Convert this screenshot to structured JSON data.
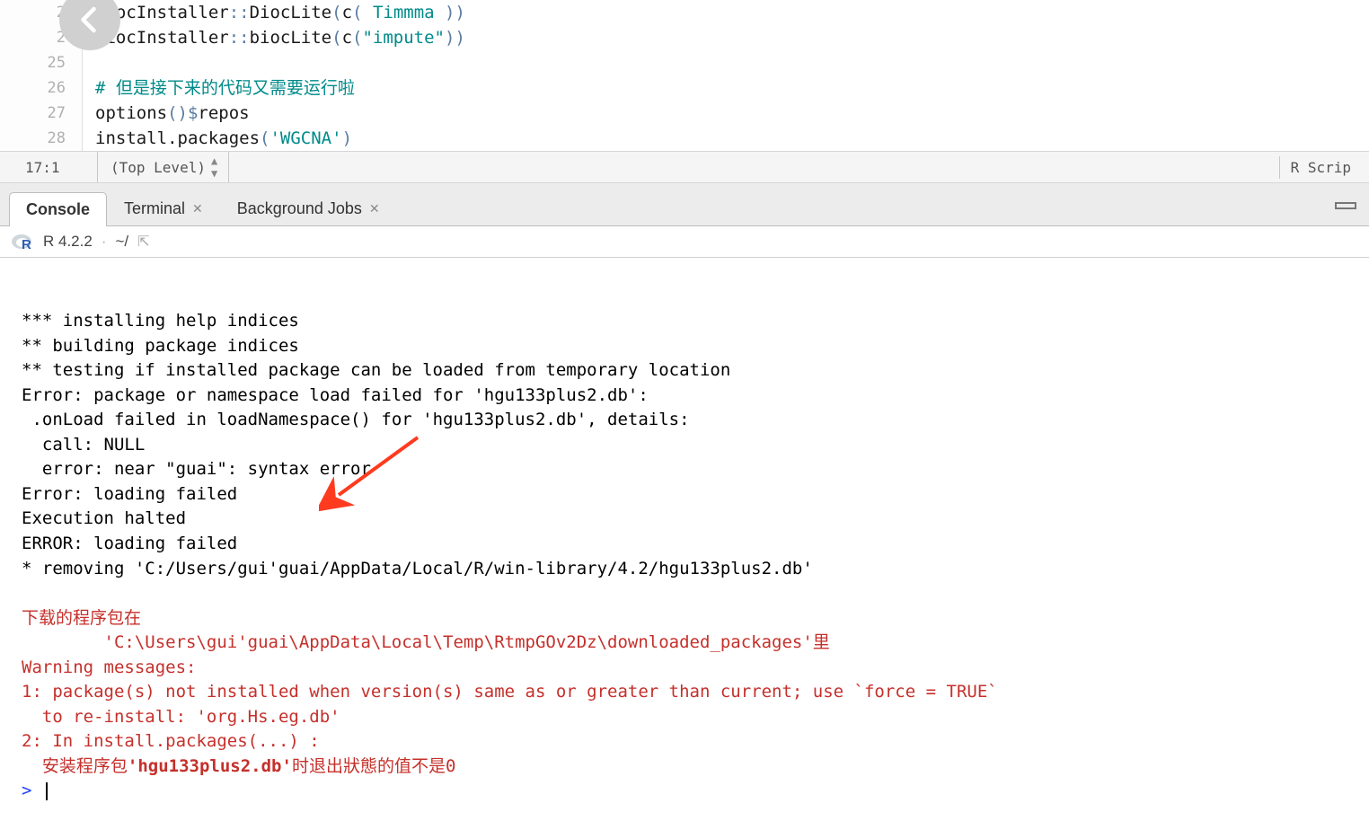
{
  "editor": {
    "lines": [
      {
        "num": "2",
        "html": "<span class='tok-ident'>DiocInstaller</span><span class='tok-op'>::</span><span class='tok-ident'>DiocLite</span><span class='tok-op'>(</span><span class='tok-ident'>c</span><span class='tok-op'>(</span> <span class='tok-str'>Timmma</span> <span class='tok-op'>))</span>"
      },
      {
        "num": "2",
        "html": "<span class='tok-ident'>BiocInstaller</span><span class='tok-op'>::</span><span class='tok-ident'>biocLite</span><span class='tok-op'>(</span><span class='tok-ident'>c</span><span class='tok-op'>(</span><span class='tok-str'>\"impute\"</span><span class='tok-op'>))</span>"
      },
      {
        "num": "25",
        "html": ""
      },
      {
        "num": "26",
        "html": "<span class='tok-comment'># 但是接下来的代码又需要运行啦</span>"
      },
      {
        "num": "27",
        "html": "<span class='tok-ident'>options</span><span class='tok-op'>()</span><span class='tok-dollar'>$</span><span class='tok-ident'>repos</span>"
      },
      {
        "num": "28",
        "html": "<span class='tok-ident'>install.packages</span><span class='tok-op'>(</span><span class='tok-str'>'WGCNA'</span><span class='tok-op'>)</span>"
      }
    ],
    "cursor_pos": "17:1",
    "scope": "(Top Level)",
    "language": "R Scrip"
  },
  "tabs": {
    "items": [
      {
        "label": "Console",
        "active": true,
        "closable": false
      },
      {
        "label": "Terminal",
        "active": false,
        "closable": true
      },
      {
        "label": "Background Jobs",
        "active": false,
        "closable": true
      }
    ]
  },
  "console_header": {
    "version": "R 4.2.2",
    "sep": "·",
    "cwd": "~/"
  },
  "console": {
    "lines": [
      {
        "cls": "cout-black",
        "text": "*** installing help indices"
      },
      {
        "cls": "cout-black",
        "text": "** building package indices"
      },
      {
        "cls": "cout-black",
        "text": "** testing if installed package can be loaded from temporary location"
      },
      {
        "cls": "cout-black",
        "text": "Error: package or namespace load failed for 'hgu133plus2.db':"
      },
      {
        "cls": "cout-black",
        "text": " .onLoad failed in loadNamespace() for 'hgu133plus2.db', details:"
      },
      {
        "cls": "cout-black",
        "text": "  call: NULL"
      },
      {
        "cls": "cout-black",
        "text": "  error: near \"guai\": syntax error"
      },
      {
        "cls": "cout-black",
        "text": "Error: loading failed"
      },
      {
        "cls": "cout-black",
        "text": "Execution halted"
      },
      {
        "cls": "cout-black",
        "text": "ERROR: loading failed"
      },
      {
        "cls": "cout-black",
        "text": "* removing 'C:/Users/gui'guai/AppData/Local/R/win-library/4.2/hgu133plus2.db'"
      },
      {
        "cls": "cout-black",
        "text": ""
      },
      {
        "cls": "cout-red",
        "text": "下载的程序包在"
      },
      {
        "cls": "cout-red",
        "text": "        'C:\\Users\\gui'guai\\AppData\\Local\\Temp\\RtmpGOv2Dz\\downloaded_packages'里"
      },
      {
        "cls": "cout-red",
        "text": "Warning messages:"
      },
      {
        "cls": "cout-red",
        "text": "1: package(s) not installed when version(s) same as or greater than current; use `force = TRUE`"
      },
      {
        "cls": "cout-red",
        "text": "  to re-install: 'org.Hs.eg.db' "
      },
      {
        "cls": "cout-red",
        "text": "2: In install.packages(...) :"
      }
    ],
    "mixed_line": {
      "red_prefix": "  安装程序包",
      "bold_pkg": "'hgu133plus2.db'",
      "red_suffix": "时退出狀態的值不是0"
    },
    "prompt": "> "
  }
}
